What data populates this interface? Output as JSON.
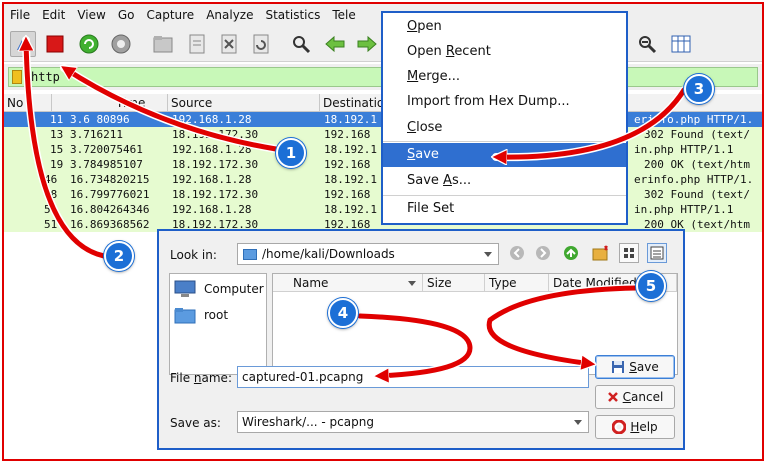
{
  "menubar": [
    "File",
    "Edit",
    "View",
    "Go",
    "Capture",
    "Analyze",
    "Statistics",
    "Tele"
  ],
  "toolbar": {
    "icons": [
      "shark-fin-icon",
      "stop-capture-icon",
      "restart-capture-icon",
      "capture-options-icon",
      "open-file-icon",
      "save-file-icon",
      "close-file-icon",
      "reload-file-icon",
      "find-packet-icon",
      "go-back-icon",
      "go-forward-icon",
      "zoom-out-icon",
      "resize-columns-icon"
    ]
  },
  "filter": {
    "value": "http"
  },
  "packet_list": {
    "columns": [
      "No",
      "Time",
      "Source",
      "Destination"
    ],
    "rows": [
      {
        "no": "11",
        "time": "3.6   80896",
        "src": "192.168.1.28",
        "dst": "18.192.1",
        "info": "erinfo.php HTTP/1."
      },
      {
        "no": "13",
        "time": "3.716211",
        "src": "18.192.172.30",
        "dst": "192.168",
        "info": "302 Found  (text/"
      },
      {
        "no": "15",
        "time": "3.720075461",
        "src": "192.168.1.28",
        "dst": "18.192.1",
        "info": "in.php HTTP/1.1"
      },
      {
        "no": "19",
        "time": "3.784985107",
        "src": "18.192.172.30",
        "dst": "192.168",
        "info": "200 OK  (text/htm"
      },
      {
        "no": "46",
        "time": "16.734820215",
        "src": "192.168.1.28",
        "dst": "18.192.1",
        "info": "erinfo.php HTTP/1."
      },
      {
        "no": "48",
        "time": "16.799776021",
        "src": "18.192.172.30",
        "dst": "192.168",
        "info": "302 Found  (text/"
      },
      {
        "no": "50",
        "time": "16.804264346",
        "src": "192.168.1.28",
        "dst": "18.192.1",
        "info": "in.php HTTP/1.1"
      },
      {
        "no": "51",
        "time": "16.869368562",
        "src": "18.192.172.30",
        "dst": "192.168",
        "info": "200 OK  (text/htm"
      }
    ]
  },
  "file_menu": [
    {
      "pre": "",
      "u": "O",
      "post": "pen"
    },
    {
      "pre": "Open ",
      "u": "R",
      "post": "ecent"
    },
    {
      "pre": "",
      "u": "M",
      "post": "erge..."
    },
    {
      "pre": "Import from Hex Dump...",
      "u": "",
      "post": ""
    },
    {
      "pre": "",
      "u": "C",
      "post": "lose"
    },
    {
      "pre": "",
      "u": "S",
      "post": "ave"
    },
    {
      "pre": "Save ",
      "u": "A",
      "post": "s..."
    },
    {
      "pre": "File Set",
      "u": "",
      "post": ""
    }
  ],
  "dialog": {
    "look_in_label": "Look in:",
    "look_in_value": "/home/kali/Downloads",
    "places": [
      "Computer",
      "root"
    ],
    "columns": [
      "Name",
      "Size",
      "Type",
      "Date Modified"
    ],
    "file_name_label": {
      "pre": "File ",
      "u": "n",
      "post": "ame:"
    },
    "file_name_value": "captured-01.pcapng",
    "save_as_label": "Save as:",
    "save_as_value": "Wireshark/... - pcapng",
    "buttons": {
      "save": {
        "pre": "",
        "u": "S",
        "post": "ave"
      },
      "cancel": {
        "pre": "",
        "u": "C",
        "post": "ancel"
      },
      "help": {
        "pre": "",
        "u": "H",
        "post": "elp"
      }
    }
  },
  "callouts": [
    "1",
    "2",
    "3",
    "4",
    "5"
  ],
  "colors": {
    "annotation_red": "#e00000",
    "callout_blue": "#1c6fd6",
    "selection_blue": "#3a7ed8",
    "http_row_green": "#e6fbd0",
    "filter_green": "#c8f8b8"
  }
}
